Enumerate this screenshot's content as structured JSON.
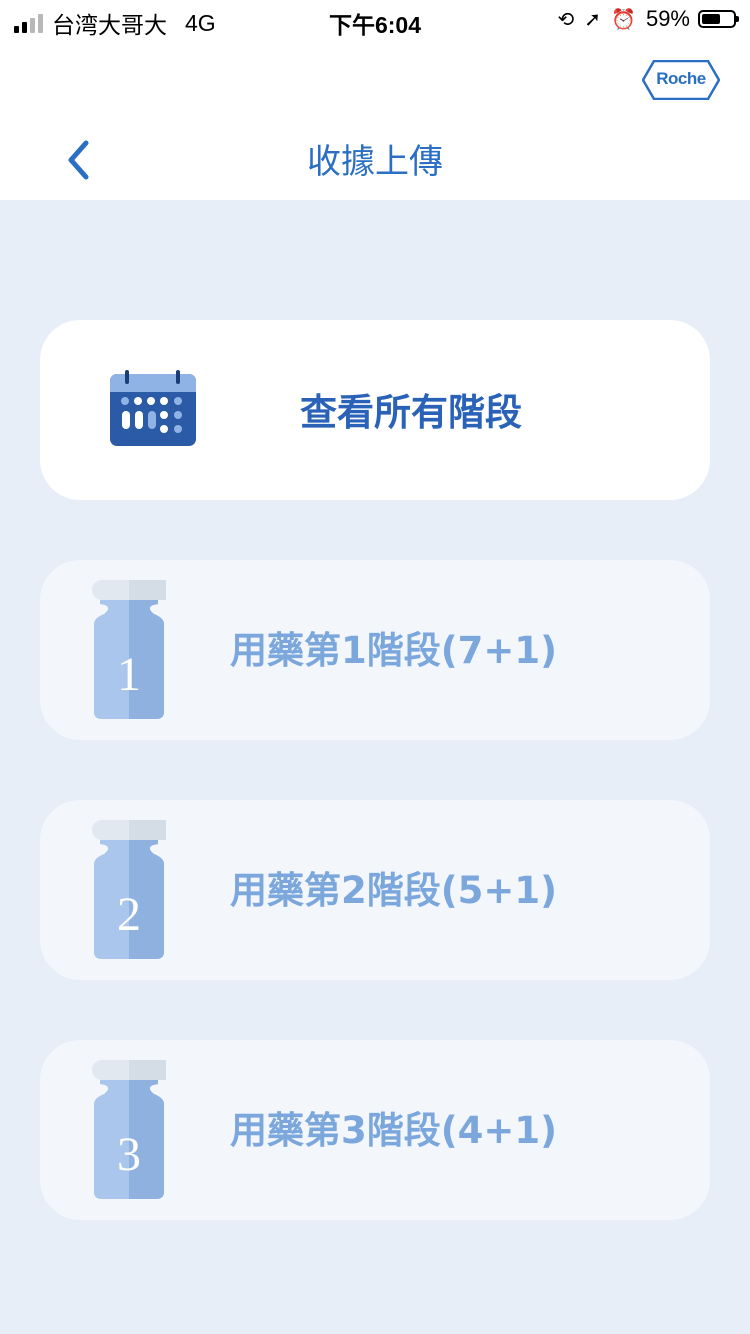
{
  "status_bar": {
    "carrier": "台湾大哥大",
    "network": "4G",
    "time": "下午6:04",
    "battery_percent": "59%",
    "battery_level": 0.59
  },
  "header": {
    "logo_text": "Roche",
    "title": "收據上傳"
  },
  "main_card": {
    "label": "查看所有階段",
    "icon": "calendar-icon"
  },
  "stages": [
    {
      "number": "1",
      "label": "用藥第1階段(7+1)",
      "icon": "vial-icon"
    },
    {
      "number": "2",
      "label": "用藥第2階段(5+1)",
      "icon": "vial-icon"
    },
    {
      "number": "3",
      "label": "用藥第3階段(4+1)",
      "icon": "vial-icon"
    }
  ],
  "colors": {
    "accent": "#2a6fc4",
    "title_blue": "#2a62b8",
    "stage_text": "#7ba7dc",
    "page_bg": "#e7eef8",
    "card_bg": "#ffffff",
    "stage_card_bg": "#f3f7fc"
  }
}
